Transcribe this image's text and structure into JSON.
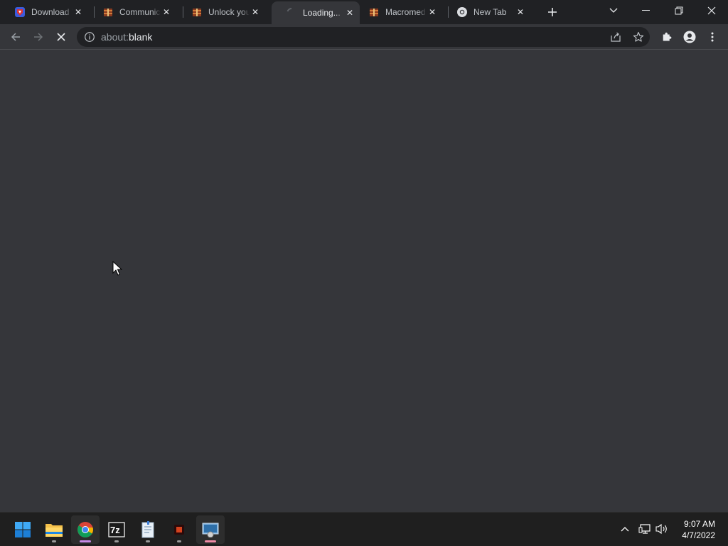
{
  "browser": {
    "tabs": [
      {
        "title": "Download V",
        "icon": "shield-favicon",
        "active": false
      },
      {
        "title": "Communica",
        "icon": "winrar-favicon",
        "active": false
      },
      {
        "title": "Unlock you",
        "icon": "winrar-favicon",
        "active": false
      },
      {
        "title": "Loading...",
        "icon": "loading-spinner",
        "active": true
      },
      {
        "title": "Macromed",
        "icon": "winrar-favicon",
        "active": false
      },
      {
        "title": "New Tab",
        "icon": "chrome-favicon",
        "active": false
      }
    ],
    "address": {
      "scheme": "about:",
      "host": "blank"
    }
  },
  "taskbar": {
    "apps": [
      {
        "name": "start",
        "icon": "windows-start-icon"
      },
      {
        "name": "file-explorer",
        "icon": "folder-icon"
      },
      {
        "name": "chrome",
        "icon": "chrome-icon"
      },
      {
        "name": "7zip",
        "icon": "7zip-icon"
      },
      {
        "name": "notepad",
        "icon": "notepad-icon"
      },
      {
        "name": "app",
        "icon": "app-icon"
      },
      {
        "name": "installer",
        "icon": "installer-icon"
      }
    ],
    "clock": {
      "time": "9:07 AM",
      "date": "4/7/2022"
    }
  },
  "colors": {
    "tabstrip": "#202124",
    "toolbar": "#35363a",
    "omnibox": "#202124",
    "taskbar": "#1f1f1f"
  }
}
